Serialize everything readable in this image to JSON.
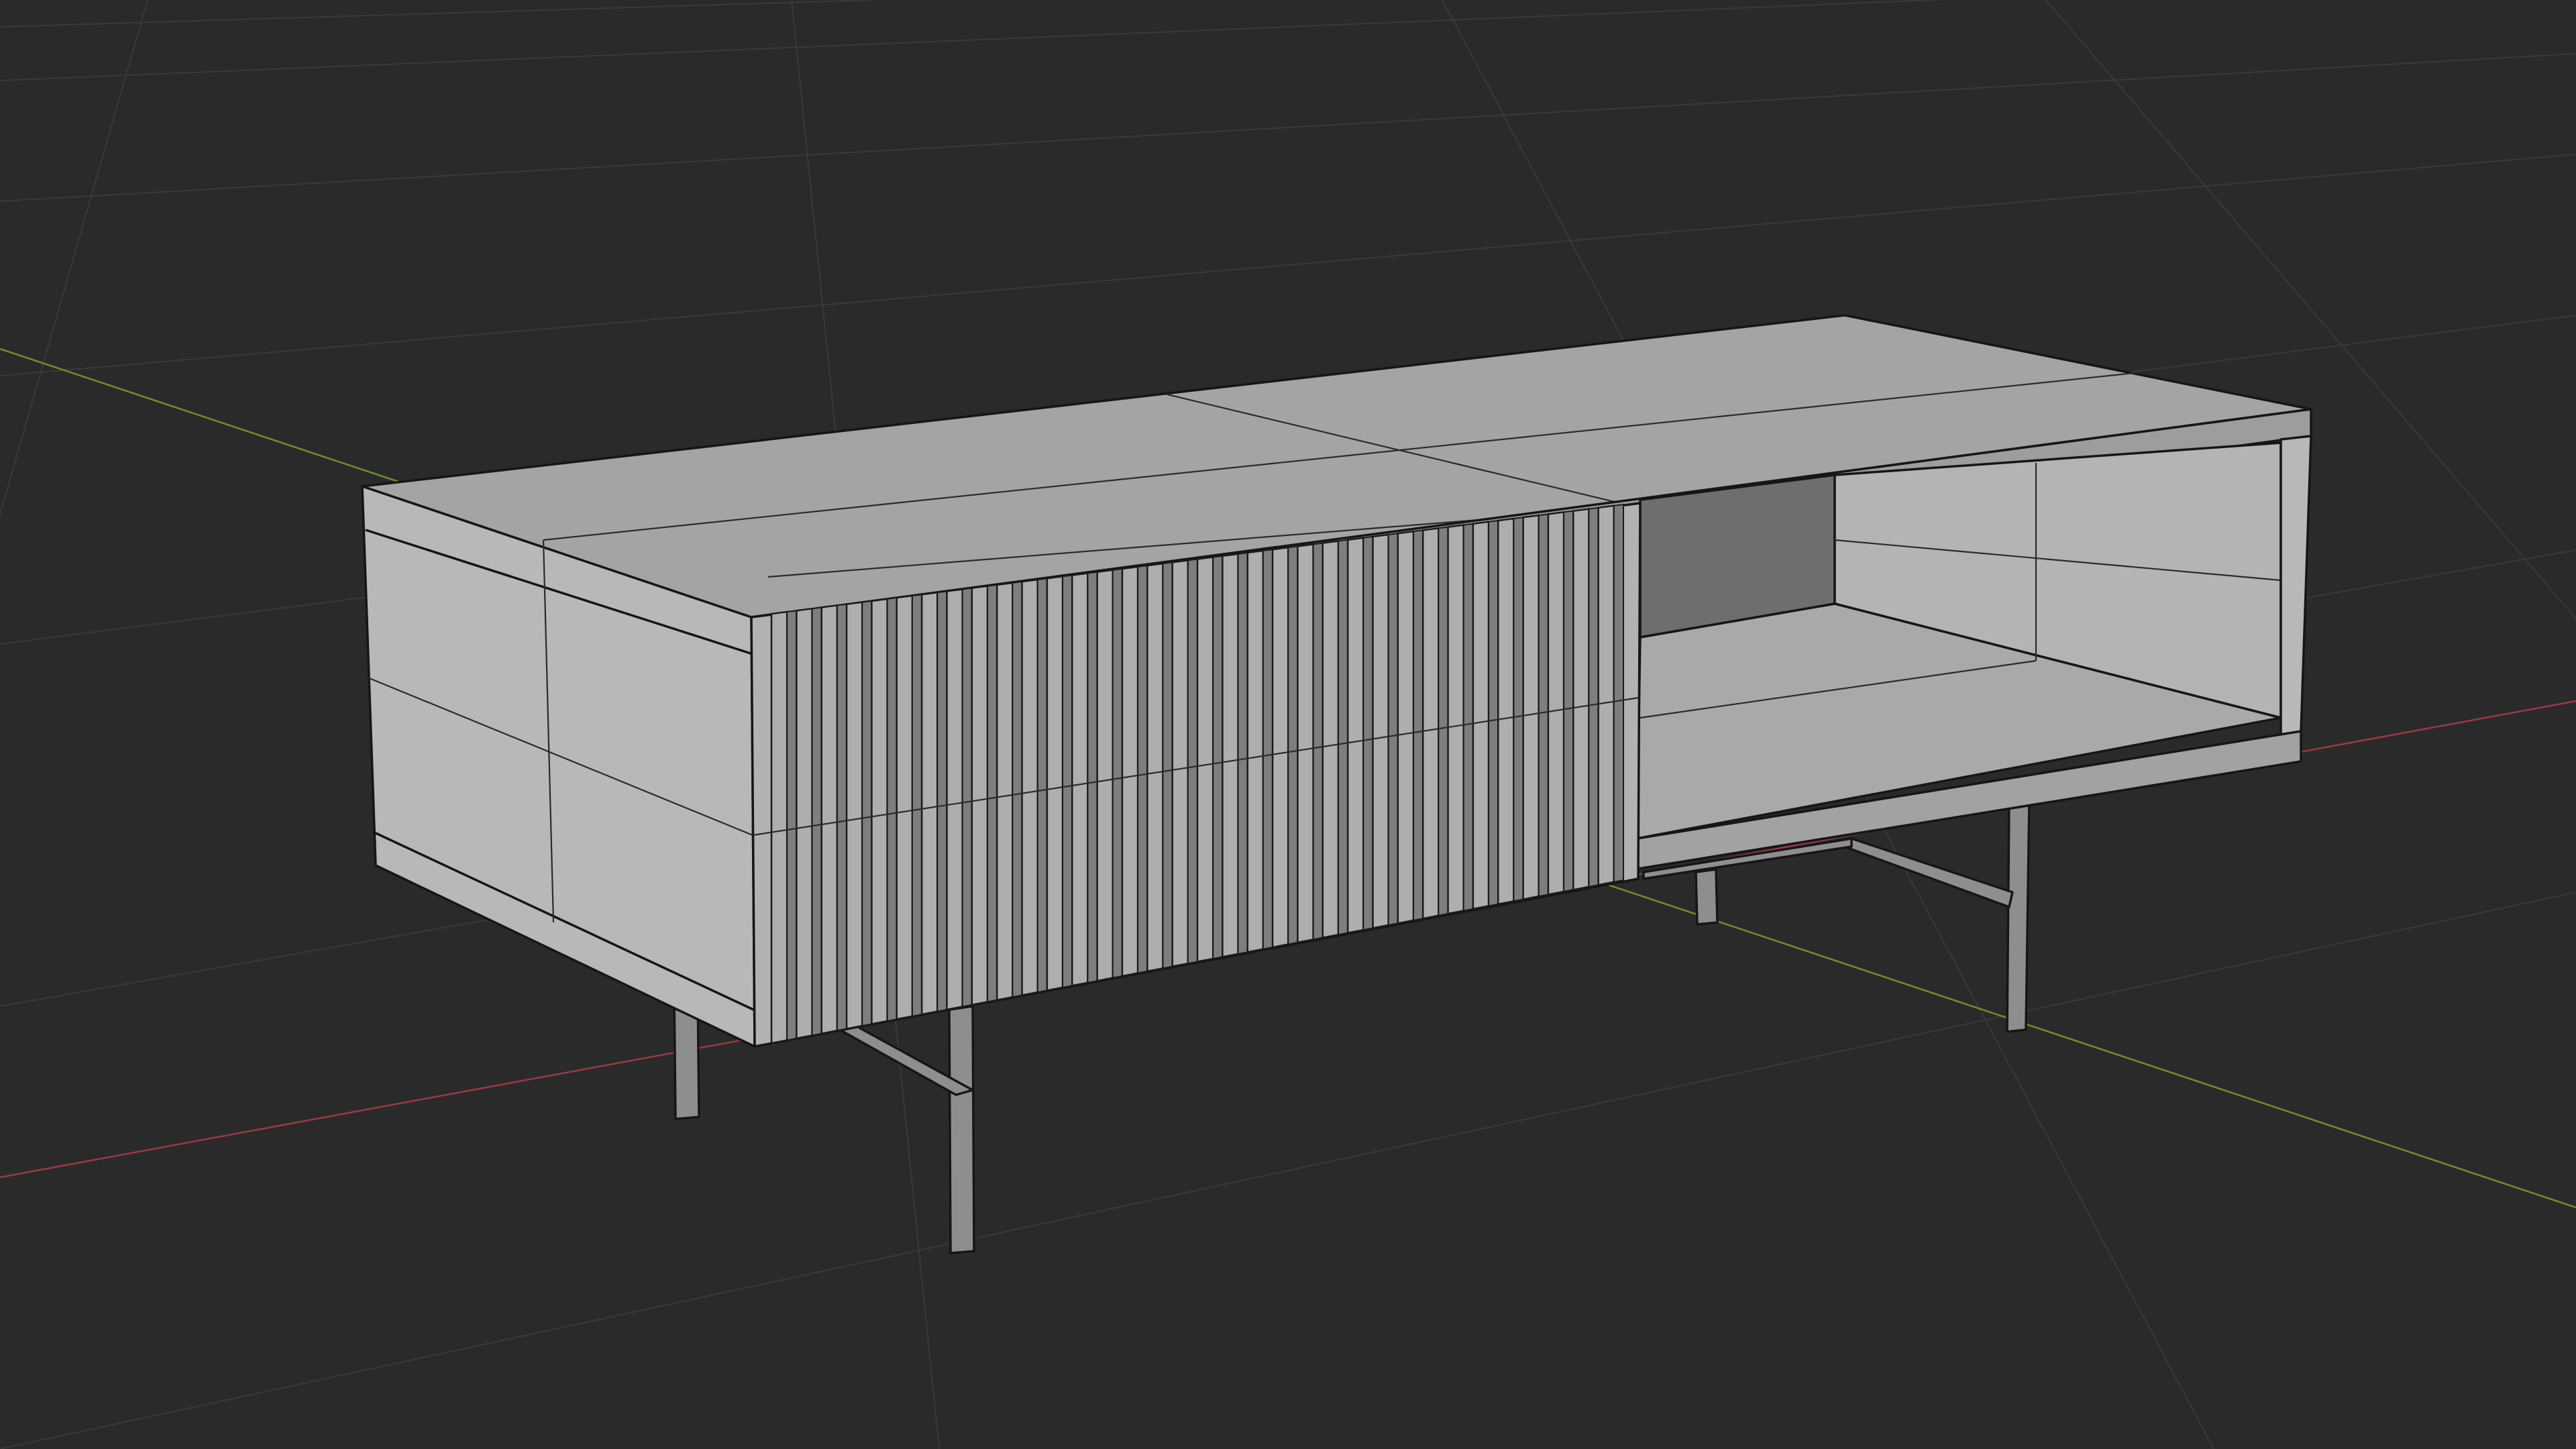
{
  "viewport": {
    "background": "#2a2a2a",
    "grid_color": "#3a3a3a",
    "x_axis_color": "#9b3a44",
    "y_axis_color": "#6f8f2f",
    "shading": "solid",
    "wireframe_overlay": true
  },
  "object": {
    "kind": "sideboard",
    "face_colors": {
      "top": "#a4a4a4",
      "top_back": "#9d9d9d",
      "front_left": "#b2b2b2",
      "slat_light": "#aeaeae",
      "slat_dark": "#7e7e7e",
      "end_side": "#b8b8b8",
      "interior_back": "#6e6e6e",
      "interior_side": "#b4b4b4",
      "interior_floor": "#a9a9a9",
      "shelf": "#a2a2a2",
      "leg": "#8e8e8e"
    }
  }
}
